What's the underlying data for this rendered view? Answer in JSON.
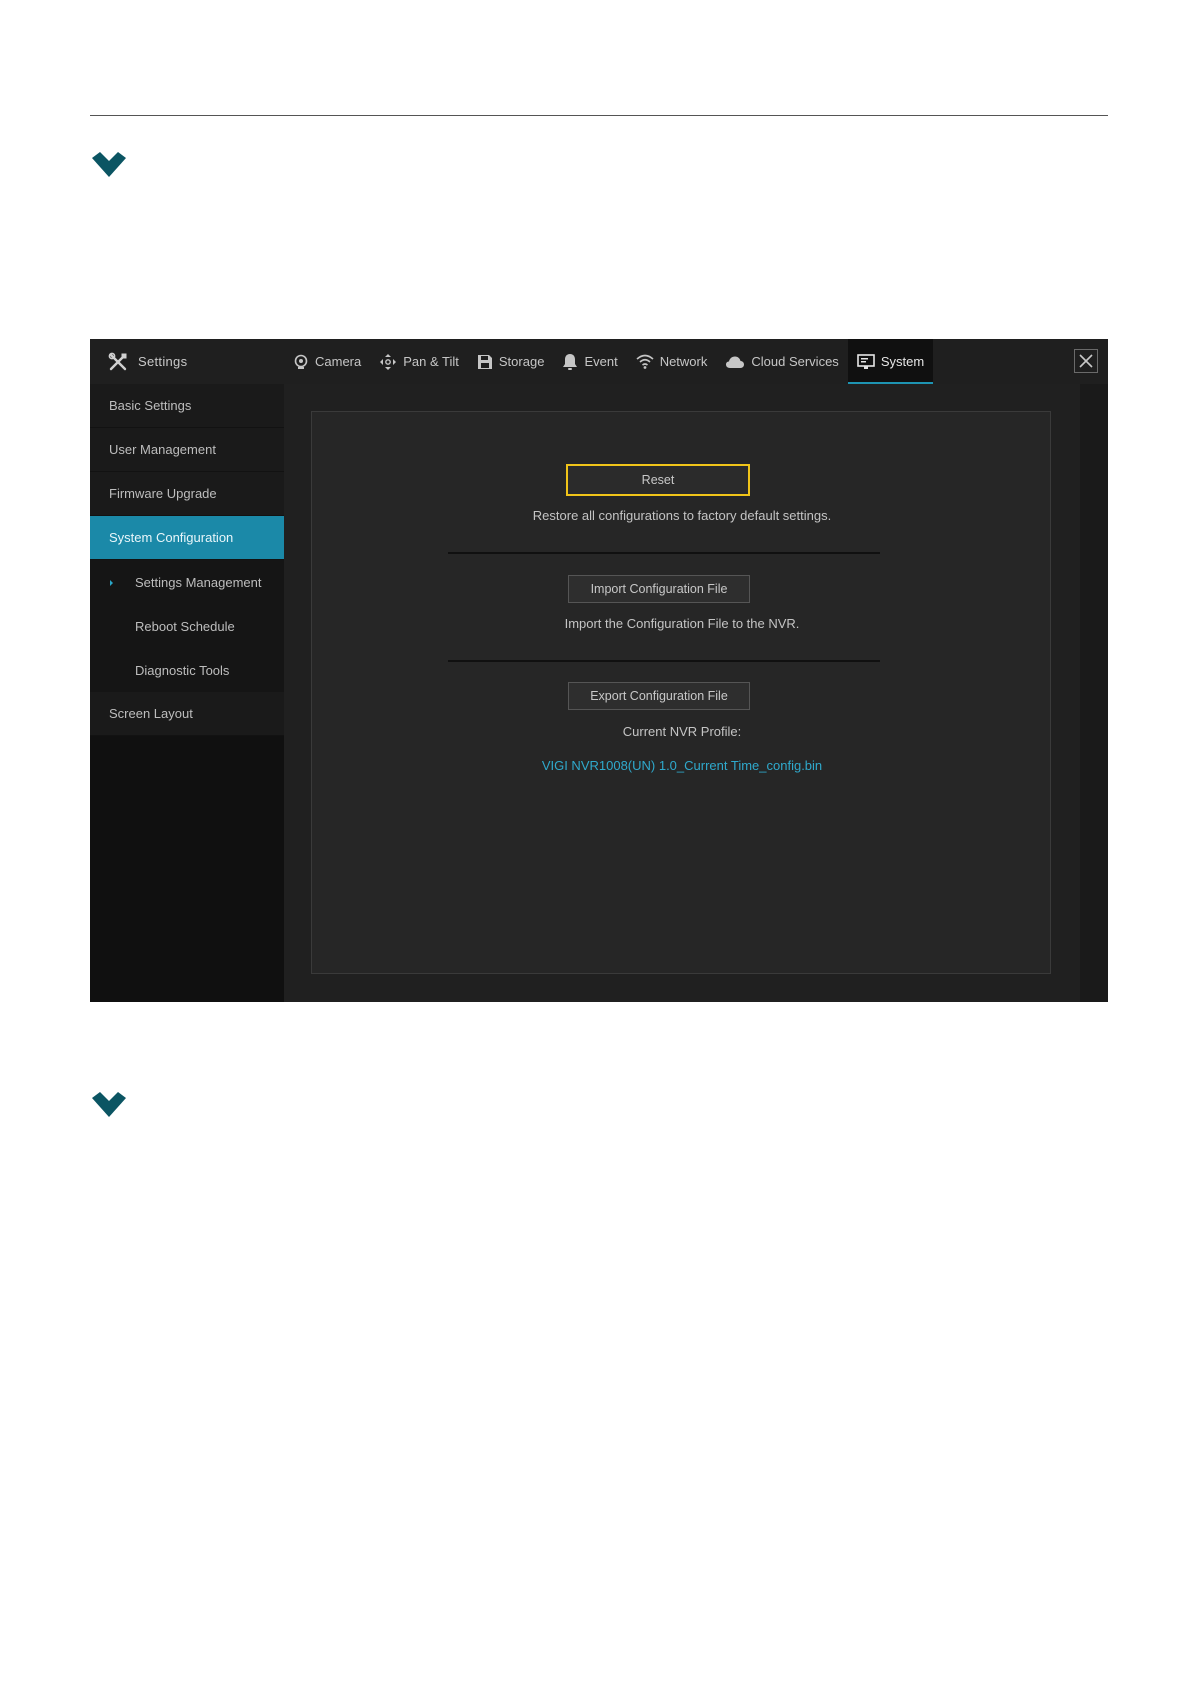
{
  "colors": {
    "accent": "#1b89a8",
    "link": "#2fa9cc",
    "focus_outline": "#f0c419",
    "chevron": "#0b5563"
  },
  "header": {
    "title": "Settings",
    "icon": "tools-icon",
    "tabs": [
      {
        "label": "Camera",
        "icon": "camera-icon"
      },
      {
        "label": "Pan & Tilt",
        "icon": "pan-tilt-icon"
      },
      {
        "label": "Storage",
        "icon": "floppy-disk-icon"
      },
      {
        "label": "Event",
        "icon": "bell-icon"
      },
      {
        "label": "Network",
        "icon": "wifi-icon"
      },
      {
        "label": "Cloud Services",
        "icon": "cloud-icon"
      },
      {
        "label": "System",
        "icon": "monitor-icon",
        "active": true
      }
    ]
  },
  "sidebar": {
    "items": [
      {
        "label": "Basic Settings"
      },
      {
        "label": "User Management"
      },
      {
        "label": "Firmware Upgrade"
      },
      {
        "label": "System Configuration",
        "active": true
      },
      {
        "label": "Settings Management",
        "sub": true,
        "selected": true
      },
      {
        "label": "Reboot Schedule",
        "sub": true
      },
      {
        "label": "Diagnostic Tools",
        "sub": true
      },
      {
        "label": "Screen Layout"
      }
    ]
  },
  "main": {
    "reset_button": "Reset",
    "reset_desc": "Restore all configurations to factory default settings.",
    "import_button": "Import Configuration File",
    "import_desc": "Import the Configuration File to the NVR.",
    "export_button": "Export Configuration File",
    "profile_label": "Current NVR Profile:",
    "profile_file": "VIGI NVR1008(UN) 1.0_Current Time_config.bin"
  }
}
